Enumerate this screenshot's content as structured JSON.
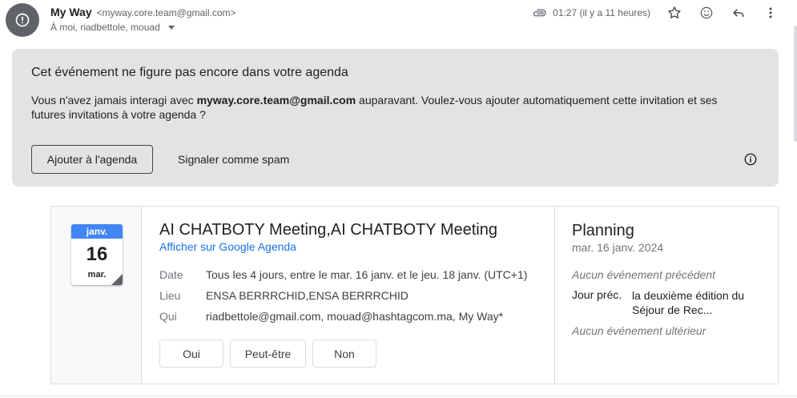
{
  "header": {
    "sender_name": "My Way",
    "sender_email": "<myway.core.team@gmail.com>",
    "recipients": "À moi, riadbettole, mouad",
    "time": "01:27 (il y a 11 heures)",
    "icons": [
      "attachment-icon",
      "star-icon",
      "emoji-icon",
      "reply-icon",
      "more-vert-icon"
    ]
  },
  "banner": {
    "title": "Cet événement ne figure pas encore dans votre agenda",
    "text_before": "Vous n'avez jamais interagi avec ",
    "text_email": "myway.core.team@gmail.com",
    "text_after": " auparavant. Voulez-vous ajouter automatiquement cette invitation et ses futures invitations à votre agenda ?",
    "add_button": "Ajouter à l'agenda",
    "spam_button": "Signaler comme spam"
  },
  "event": {
    "calendar_icon": {
      "month": "janv.",
      "day": "16",
      "weekday": "mar."
    },
    "title": "AI CHATBOTY Meeting,AI CHATBOTY Meeting",
    "google_link": "Afficher sur Google Agenda",
    "details": [
      {
        "label": "Date",
        "value": "Tous les 4 jours, entre le mar. 16 janv. et le jeu. 18 janv. (UTC+1)"
      },
      {
        "label": "Lieu",
        "value": "ENSA BERRRCHID,ENSA BERRRCHID"
      },
      {
        "label": "Qui",
        "value": "riadbettole@gmail.com, mouad@hashtagcom.ma, My Way*"
      }
    ],
    "rsvp": [
      "Oui",
      "Peut-être",
      "Non"
    ]
  },
  "planning": {
    "title": "Planning",
    "date": "mar. 16 janv. 2024",
    "no_previous": "Aucun événement précédent",
    "prev_label": "Jour préc.",
    "prev_value": "la deuxième édition du Séjour de Rec...",
    "no_next": "Aucun événement ultérieur"
  },
  "colors": {
    "banner_bg": "#e3e3e3",
    "link": "#1a73e8",
    "calendar_month_bg": "#4285f4"
  }
}
